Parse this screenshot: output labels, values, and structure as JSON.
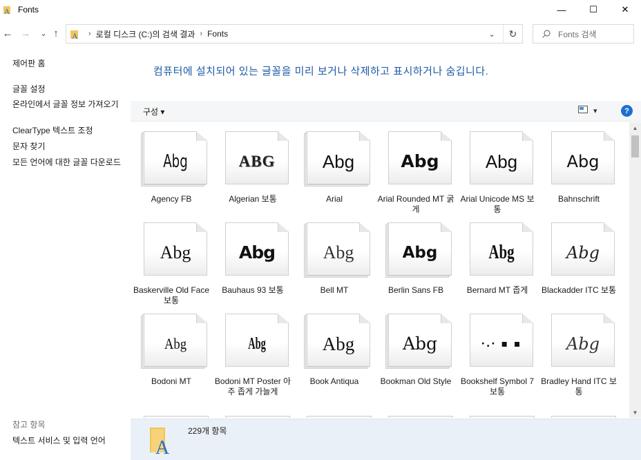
{
  "window": {
    "title": "Fonts",
    "minimize": "—",
    "maximize": "☐",
    "close": "✕"
  },
  "nav": {
    "back": "←",
    "forward": "→",
    "recent": "⌄",
    "up": "↑"
  },
  "address": {
    "segments": [
      "로컬 디스크 (C:)의 검색 결과",
      "Fonts"
    ],
    "separator": "›",
    "dropdown": "⌄",
    "refresh": "↻"
  },
  "search": {
    "placeholder": "Fonts 검색"
  },
  "left_pane": {
    "home": "제어판 홈",
    "links": [
      "글꼴 설정",
      "온라인에서 글꼴 정보 가져오기",
      "ClearType 텍스트 조정",
      "문자 찾기",
      "모든 언어에 대한 글꼴 다운로드"
    ],
    "see_also": "참고 항목",
    "see_also_links": [
      "텍스트 서비스 및 입력 언어"
    ]
  },
  "headline": "컴퓨터에 설치되어 있는 글꼴을 미리 보거나 삭제하고 표시하거나 숨깁니다.",
  "toolbar": {
    "organize": "구성 ▾",
    "view": "▾",
    "help": "?"
  },
  "fonts": [
    {
      "sample": "Abg",
      "name": "Agency FB"
    },
    {
      "sample": "ABG",
      "name": "Algerian 보통"
    },
    {
      "sample": "Abg",
      "name": "Arial"
    },
    {
      "sample": "Abg",
      "name": "Arial Rounded MT 굵게"
    },
    {
      "sample": "Abg",
      "name": "Arial Unicode MS 보통"
    },
    {
      "sample": "Abg",
      "name": "Bahnschrift"
    },
    {
      "sample": "Abg",
      "name": "Baskerville Old Face 보통"
    },
    {
      "sample": "Abg",
      "name": "Bauhaus 93 보통"
    },
    {
      "sample": "Abg",
      "name": "Bell MT"
    },
    {
      "sample": "Abg",
      "name": "Berlin Sans FB"
    },
    {
      "sample": "Abg",
      "name": "Bernard MT 좁게"
    },
    {
      "sample": "Abg",
      "name": "Blackadder ITC 보통"
    },
    {
      "sample": "Abg",
      "name": "Bodoni MT"
    },
    {
      "sample": "Abg",
      "name": "Bodoni MT Poster 아주 좁게 가늘게"
    },
    {
      "sample": "Abg",
      "name": "Book Antiqua"
    },
    {
      "sample": "Abg",
      "name": "Bookman Old Style"
    },
    {
      "sample": "·.·  ▪  ▪",
      "name": "Bookshelf Symbol 7 보통"
    },
    {
      "sample": "Abg",
      "name": "Bradley Hand ITC 보통"
    }
  ],
  "details": {
    "count": "229개 항목"
  },
  "colors": {
    "accent": "#1e5aa6",
    "details_bg": "#e9f0f8",
    "help": "#1c6fd1"
  }
}
